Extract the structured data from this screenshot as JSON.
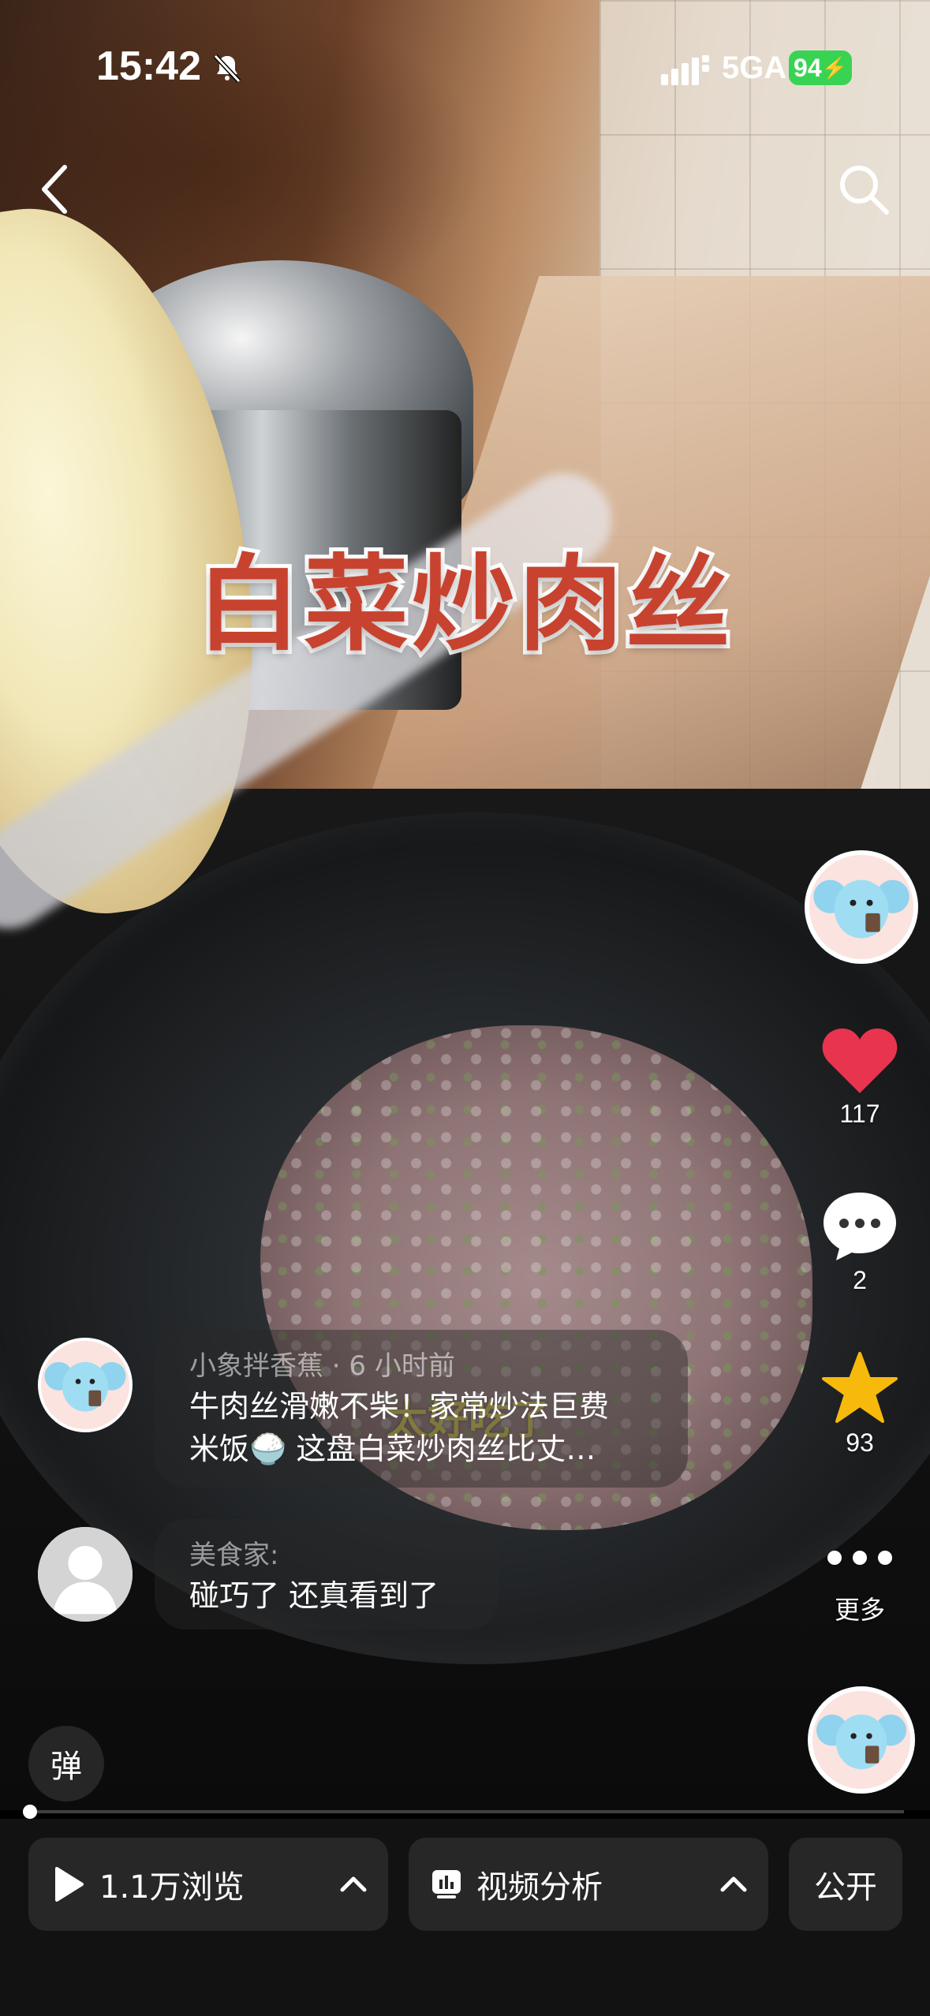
{
  "status_bar": {
    "time": "15:42",
    "network": "5GA",
    "battery": "94",
    "battery_color": "#39d353"
  },
  "nav": {
    "back_icon": "chevron-left-icon",
    "search_icon": "search-icon"
  },
  "video": {
    "title": "白菜炒肉丝",
    "title_color": "#c7432f",
    "subtitle_caption": "太好吃了"
  },
  "actions": {
    "likes": "117",
    "comments": "2",
    "favorites": "93",
    "more_label": "更多",
    "like_color": "#e8344e",
    "star_color": "#f7b90c"
  },
  "comments": [
    {
      "user": "小象拌香蕉 · 6 小时前",
      "line1": "牛肉丝滑嫩不柴！家常炒法巨费",
      "line2": "米饭🍚 这盘白菜炒肉丝比丈…"
    },
    {
      "user": "美食家:",
      "line1": "碰巧了  还真看到了"
    }
  ],
  "danmu_label": "弹",
  "progress": 0.002,
  "bottom_bar": {
    "views_label": "1.1万浏览",
    "analysis_label": "视频分析",
    "public_label": "公开"
  }
}
